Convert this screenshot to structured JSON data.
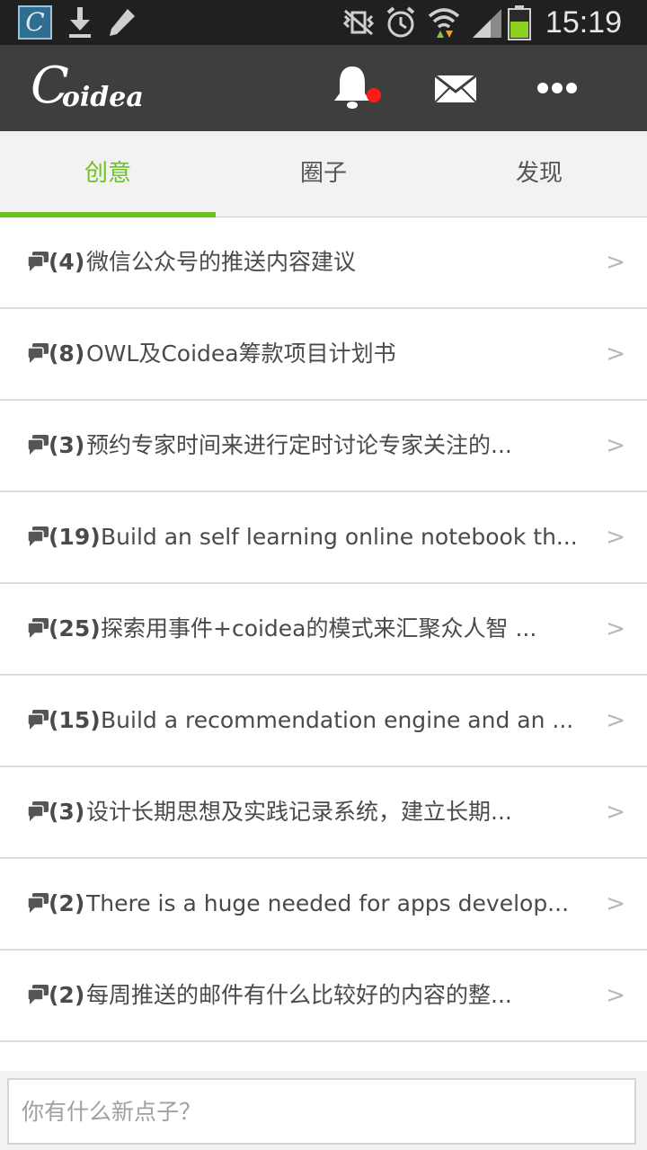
{
  "status_bar": {
    "app_icon_letter": "C",
    "time": "15:19",
    "icons": [
      "coidea-app-icon",
      "download-icon",
      "pencil-icon",
      "vibrate-off-icon",
      "alarm-icon",
      "wifi-icon",
      "signal-icon",
      "battery-icon"
    ]
  },
  "app_bar": {
    "logo_big": "C",
    "logo_small": "oidea",
    "actions": [
      "bell-icon",
      "mail-icon",
      "more-icon"
    ],
    "notification_dot_color": "#ff1a1a",
    "background": "#3e3e3e"
  },
  "tabs": {
    "items": [
      {
        "label": "创意",
        "active": true
      },
      {
        "label": "圈子",
        "active": false
      },
      {
        "label": "发现",
        "active": false
      }
    ],
    "accent": "#6cc21f"
  },
  "ideas": [
    {
      "count": "(4)",
      "title": "微信公众号的推送内容建议"
    },
    {
      "count": "(8)",
      "title": "OWL及Coidea筹款项目计划书"
    },
    {
      "count": "(3)",
      "title": "预约专家时间来进行定时讨论专家关注的..."
    },
    {
      "count": "(19)",
      "title": "Build an self learning online notebook th..."
    },
    {
      "count": "(25)",
      "title": "探索用事件+coidea的模式来汇聚众人智 ..."
    },
    {
      "count": "(15)",
      "title": "Build a recommendation engine and an ..."
    },
    {
      "count": "(3)",
      "title": "设计长期思想及实践记录系统，建立长期..."
    },
    {
      "count": "(2)",
      "title": "There is a huge needed for apps develop..."
    },
    {
      "count": "(2)",
      "title": "每周推送的邮件有什么比较好的内容的整..."
    }
  ],
  "row_chevron": ">",
  "composer": {
    "placeholder": "你有什么新点子？"
  }
}
